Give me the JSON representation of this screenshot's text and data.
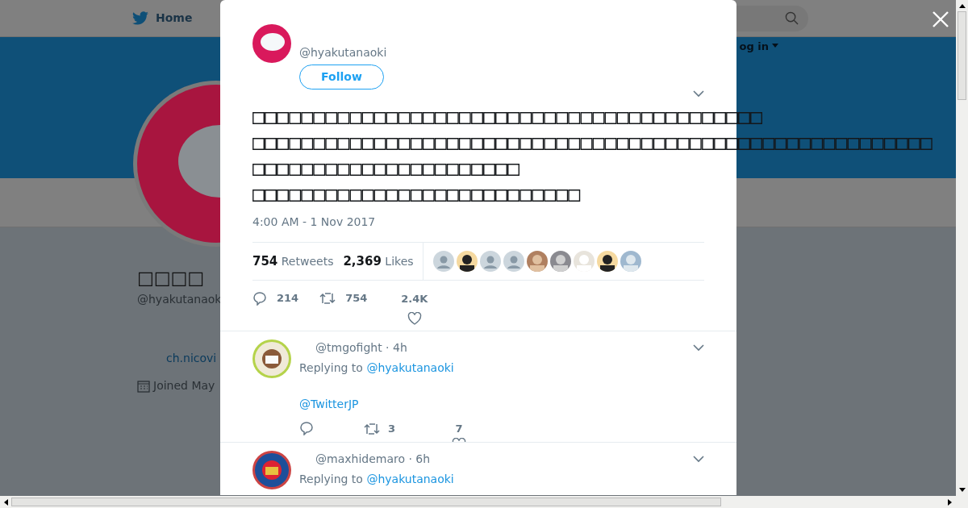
{
  "nav": {
    "home": "Home",
    "login": "og in"
  },
  "profile": {
    "name": "□□□□",
    "handle": "@hyakutanaok",
    "link": "ch.nicovi",
    "joined": "Joined May"
  },
  "tweet": {
    "handle": "@hyakutanaoki",
    "follow": "Follow",
    "lines": [
      "□□□□□□□□□□□□□□□□□□□□□□□□□□□□□□□□□□□□□□□□□□",
      "□□□□□□□□□□□□□□□□□□□□□□□□□□□□□□□□□□□□□□□□□□□□□□□□□□□□□□□□",
      "□□□□□□□□□□□□□□□□□□□□□□",
      "□□□□□□□□□□□□□□□□□□□□□□□□□□□"
    ],
    "time": "4:00 AM - 1 Nov 2017",
    "retweets": {
      "count": "754",
      "label": "Retweets"
    },
    "likes": {
      "count": "2,369",
      "label": "Likes"
    },
    "likers": [
      {
        "kind": "default"
      },
      {
        "kind": "picture"
      },
      {
        "kind": "default"
      },
      {
        "kind": "default"
      },
      {
        "kind": "picture"
      },
      {
        "kind": "picture"
      },
      {
        "kind": "picture"
      },
      {
        "kind": "picture"
      },
      {
        "kind": "picture"
      }
    ],
    "actions": {
      "replies": "214",
      "retweets": "754",
      "likes": "2.4K"
    }
  },
  "replies": [
    {
      "meta": "@tmgofight · 4h",
      "replying_label": "Replying to",
      "replying_to": "@hyakutanaoki",
      "text": "@TwitterJP",
      "retweets": "3",
      "likes": "7"
    },
    {
      "meta": "@maxhidemaro · 6h",
      "replying_label": "Replying to",
      "replying_to": "@hyakutanaoki"
    }
  ]
}
